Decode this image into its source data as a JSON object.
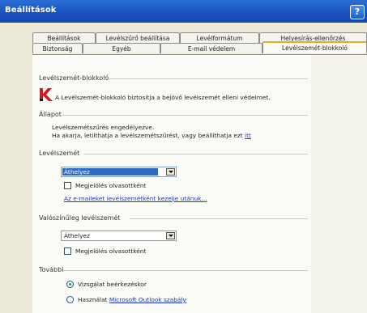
{
  "window": {
    "title": "Beállítások",
    "help_label": "?"
  },
  "tabs": {
    "row1": [
      "Beállítások",
      "Levélszűrő beállítása",
      "Levélformátum",
      "Helyesírás-ellenőrzés"
    ],
    "row2": [
      "Biztonság",
      "Egyéb",
      "E-mail védelem",
      "Levélszemét-blokkoló"
    ],
    "active": "Levélszemét-blokkoló"
  },
  "antispam": {
    "title": "Levélszemét-blokkoló",
    "description": "A Levélszemét-blokkoló biztosítja a bejövő levélszemét elleni védelmet."
  },
  "status": {
    "title": "Állapot",
    "line1": "Levélszemétszűrés engedélyezve.",
    "line2_prefix": "Ha akarja, letilthatja a levélszemétszűrést, vagy beállíthatja ezt ",
    "line2_link": "itt"
  },
  "spam": {
    "title": "Levélszemét",
    "action_value": "Áthelyez",
    "mark_read_label": "Megjelölés olvasottként",
    "link": "Az e-maileket levélszemétként kezelje utánuk..."
  },
  "probable_spam": {
    "title": "Valószínűleg levélszemét",
    "action_value": "Áthelyez",
    "mark_read_label": "Megjelölés olvasottként"
  },
  "more": {
    "title": "További",
    "radio1": "Vizsgálat beérkezéskor",
    "radio2_prefix": "Használat ",
    "radio2_link": "Microsoft Outlook szabály"
  },
  "colors": {
    "titlebar": "#1d58c4",
    "selection": "#316ac5",
    "link": "#1a34c8",
    "active_tab_accent": "#f5a623"
  }
}
